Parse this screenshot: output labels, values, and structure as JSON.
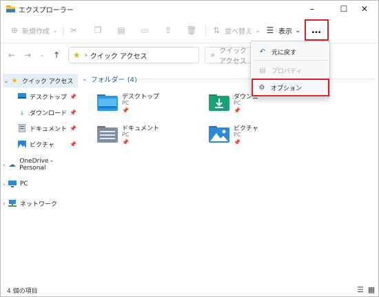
{
  "window": {
    "title": "エクスプローラー",
    "minimize_glyph": "–",
    "maximize_glyph": "☐",
    "close_glyph": "✕"
  },
  "commandbar": {
    "new_label": "新規作成",
    "new_chevron": "⌄",
    "sort_label": "並べ替え",
    "sort_chevron": "⌄",
    "view_label": "表示",
    "view_chevron": "⌄",
    "more_label": "…"
  },
  "address": {
    "path_label": "クイック アクセス",
    "search_placeholder": "クイック アクセス"
  },
  "sidebar": {
    "items": [
      {
        "label": "クイック アクセス",
        "icon": "star-icon"
      },
      {
        "label": "デスクトップ",
        "icon": "desktop-icon"
      },
      {
        "label": "ダウンロード",
        "icon": "download-icon"
      },
      {
        "label": "ドキュメント",
        "icon": "document-icon"
      },
      {
        "label": "ピクチャ",
        "icon": "picture-icon"
      },
      {
        "label": "OneDrive - Personal",
        "icon": "onedrive-icon"
      },
      {
        "label": "PC",
        "icon": "pc-icon"
      },
      {
        "label": "ネットワーク",
        "icon": "network-icon"
      }
    ]
  },
  "main": {
    "group_header": "フォルダー (4)",
    "folders": [
      {
        "name": "デスクトップ",
        "location": "PC"
      },
      {
        "name": "ダウンロ",
        "location": "PC"
      },
      {
        "name": "ドキュメント",
        "location": "PC"
      },
      {
        "name": "ピクチャ",
        "location": "PC"
      }
    ]
  },
  "menu": {
    "items": [
      {
        "label": "元に戻す",
        "enabled": true
      },
      {
        "label": "プロパティ",
        "enabled": false
      },
      {
        "label": "オプション",
        "enabled": true,
        "highlighted": true
      }
    ]
  },
  "status": {
    "item_count": "4 個の項目"
  },
  "colors": {
    "highlight_border": "#d6201f",
    "accent_link": "#1f5aa6",
    "star": "#f0b400",
    "selection": "#e5edf7"
  }
}
